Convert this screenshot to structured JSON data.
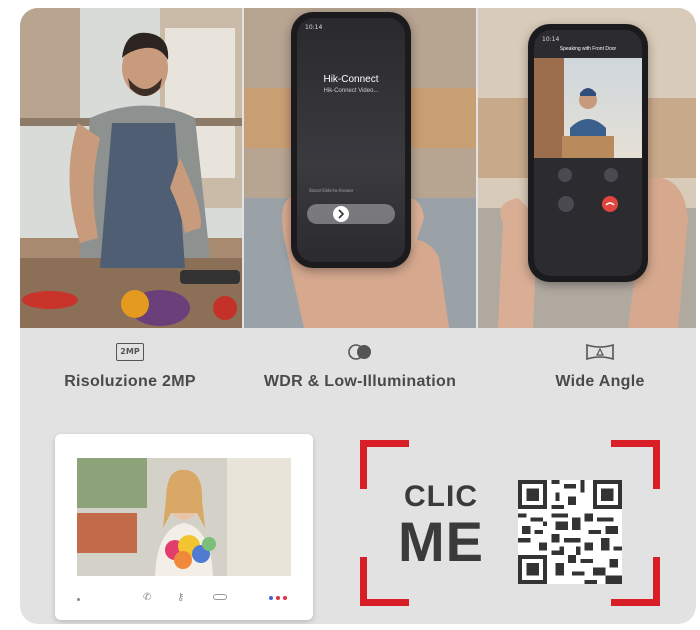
{
  "phone_call": {
    "time": "10:14",
    "caller": "Hik-Connect",
    "subtitle": "Hik-Connect Video...",
    "answer_hint": "Stand-Slide-to-Answer"
  },
  "phone_live": {
    "time": "10:14",
    "title": "Speaking with Front Door"
  },
  "features": [
    {
      "icon": "2mp-icon",
      "icon_text": "2MP",
      "label": "Risoluzione 2MP"
    },
    {
      "icon": "wdr-icon",
      "label": "WDR & Low-Illumination"
    },
    {
      "icon": "wide-angle-icon",
      "label": "Wide Angle"
    }
  ],
  "cta": {
    "line1": "CLIC",
    "line2": "ME"
  },
  "colors": {
    "accent": "#d81e26",
    "card_bg": "#e2e2e2",
    "text": "#4a4a4a"
  }
}
